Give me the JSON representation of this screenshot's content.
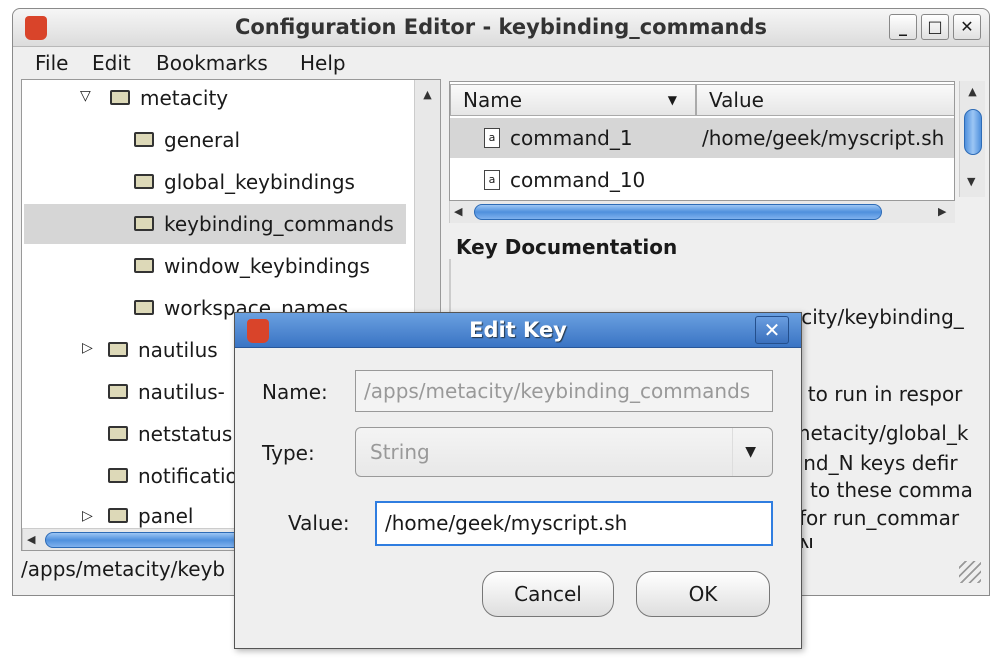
{
  "window": {
    "title": "Configuration Editor - keybinding_commands",
    "minimize": "_",
    "maximize": "□",
    "close": "✕"
  },
  "menu": [
    {
      "label": "File"
    },
    {
      "label": "Edit"
    },
    {
      "label": "Bookmarks"
    },
    {
      "label": "Help"
    }
  ],
  "tree": {
    "parent": "metacity",
    "children": [
      "general",
      "global_keybindings",
      "keybinding_commands",
      "window_keybindings",
      "workspace_names"
    ],
    "selected": "keybinding_commands",
    "siblings": [
      "nautilus",
      "nautilus-",
      "netstatus",
      "notificatio",
      "panel"
    ]
  },
  "list": {
    "columns": [
      "Name",
      "Value"
    ],
    "rows": [
      {
        "name": "command_1",
        "value": "/home/geek/myscript.sh"
      },
      {
        "name": "command_10",
        "value": ""
      }
    ]
  },
  "doc": {
    "title": "Key Documentation",
    "lines": [
      "acity/keybinding_",
      "s to run in respor",
      "metacity/global_k",
      "and_N keys defir",
      "d to these comma",
      "for run_commar",
      "N"
    ]
  },
  "status": "/apps/metacity/keyb",
  "dialog": {
    "title": "Edit Key",
    "close": "✕",
    "name_label": "Name:",
    "name_value": "/apps/metacity/keybinding_commands",
    "type_label": "Type:",
    "type_value": "String",
    "value_label": "Value:",
    "value": "/home/geek/myscript.sh",
    "cancel": "Cancel",
    "ok": "OK"
  },
  "colors": {
    "selection": "#d6d6d6",
    "accent": "#3a74c4",
    "focus": "#2f7de0"
  }
}
